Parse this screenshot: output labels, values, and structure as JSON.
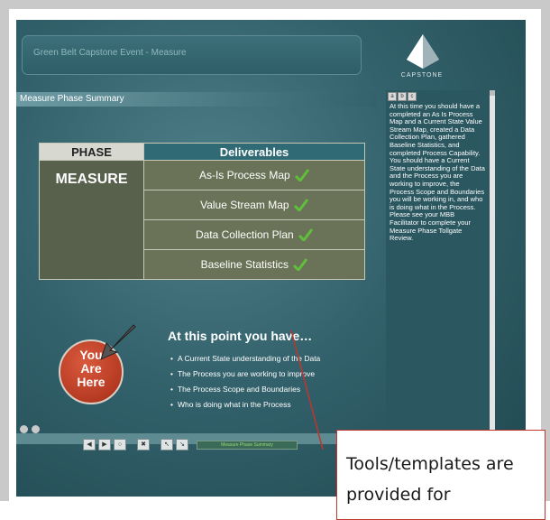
{
  "window": {
    "title": "Green Belt Capstone Event - Measure"
  },
  "logo": {
    "text": "CAPSTONE"
  },
  "section": {
    "title": "Measure Phase Summary"
  },
  "side_panel": {
    "toolbar": [
      "a",
      "b",
      "c"
    ],
    "text": "At this time you should have a completed an As Is Process Map and a Current State Value Stream Map, created a Data Collection Plan, gathered Baseline Statistics, and completed Process Capability. You should have a Current State understanding of the Data and the Process you are working to improve, the Process Scope and Boundaries you will be working in, and who is doing what in the Process. Please see your MBB Facilitator to complete your Measure Phase Tollgate Review."
  },
  "table": {
    "header_phase": "PHASE",
    "header_deliverables": "Deliverables",
    "phase_value": "MEASURE",
    "deliverables": [
      "As-Is Process Map",
      "Value Stream Map",
      "Data Collection Plan",
      "Baseline Statistics"
    ]
  },
  "badge": {
    "line1": "You",
    "line2": "Are",
    "line3": "Here"
  },
  "at_point": {
    "heading": "At this point you have…",
    "items": [
      "A Current State understanding of the Data",
      "The Process you are working to improve",
      "The Process Scope and Boundaries",
      "Who is doing what in the Process"
    ]
  },
  "player": {
    "buttons": [
      "◀",
      "▶",
      "○",
      "✖",
      "↖",
      "↘"
    ],
    "label": "Measure Phase Summary"
  },
  "callout": {
    "text": "Tools/templates are provided for"
  },
  "colors": {
    "accent": "#c0362c",
    "check": "#5fbf3a",
    "panel": "#2a5760"
  }
}
